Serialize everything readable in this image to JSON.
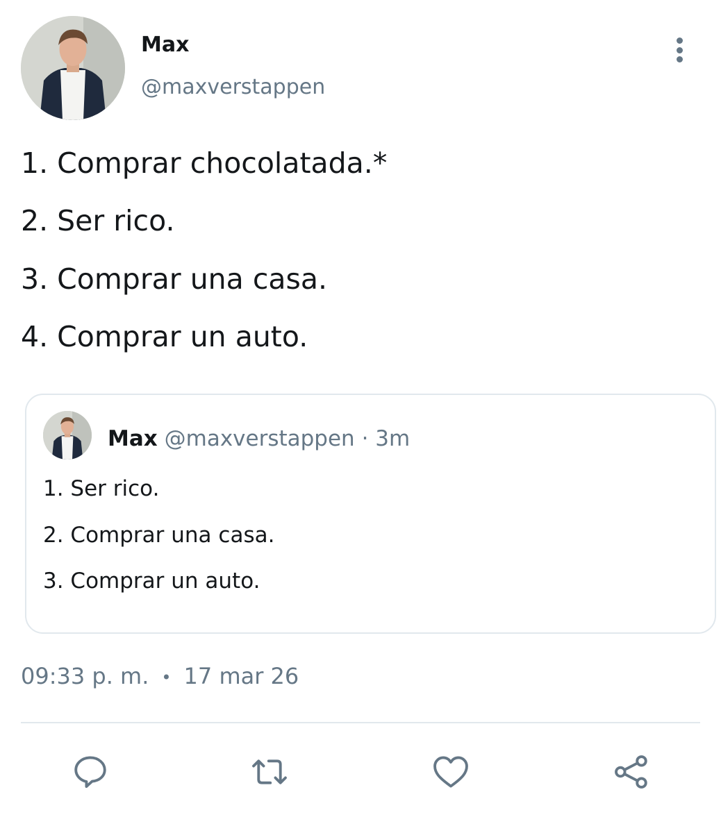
{
  "author": {
    "name": "Max",
    "handle": "@maxverstappen"
  },
  "tweet": {
    "lines": [
      "1. Comprar chocolatada.*",
      "2. Ser rico.",
      "3. Comprar una casa.",
      "4. Comprar un auto."
    ]
  },
  "quoted_tweet": {
    "name": "Max",
    "handle": "@maxverstappen",
    "separator": "·",
    "time": "3m",
    "lines": [
      "1. Ser rico.",
      "2. Comprar una casa.",
      "3. Comprar un auto."
    ]
  },
  "timestamp": {
    "time": "09:33 p. m.",
    "separator": "•",
    "date": "17 mar 26"
  },
  "actions": {
    "reply_icon": "reply-icon",
    "retweet_icon": "retweet-icon",
    "like_icon": "heart-icon",
    "share_icon": "share-icon"
  },
  "colors": {
    "text": "#14171a",
    "secondary": "#657786",
    "border": "#e1e8ed",
    "icon": "#657786"
  }
}
